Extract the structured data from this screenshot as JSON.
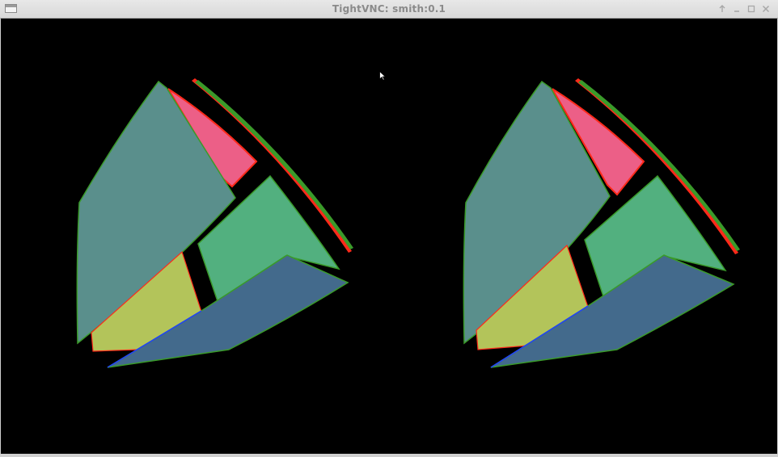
{
  "window": {
    "title": "TightVNC: smith:0.1",
    "icon": "window-icon",
    "controls": [
      {
        "name": "raise-button",
        "icon": "arrow-up-icon"
      },
      {
        "name": "minimize-button",
        "icon": "minimize-icon"
      },
      {
        "name": "maximize-button",
        "icon": "maximize-icon"
      },
      {
        "name": "close-button",
        "icon": "close-icon"
      }
    ]
  },
  "scene": {
    "background": "#000000",
    "views": [
      "left-eye-view",
      "right-eye-view"
    ],
    "colors": {
      "teal_face": "#5a8f8c",
      "pink_face": "#ec5f87",
      "green_face": "#52b07f",
      "yellow_face": "#b3c45a",
      "blue_face": "#436a8c",
      "edge_red": "#ff2a1a",
      "edge_green": "#3a9a2a"
    }
  }
}
